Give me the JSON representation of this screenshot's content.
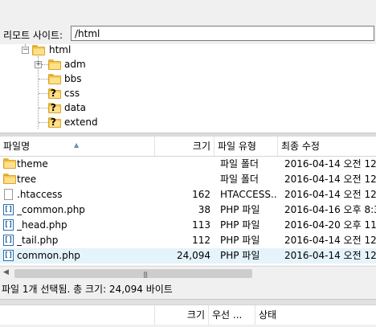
{
  "remote": {
    "label": "리모트 사이트:",
    "path": "/html"
  },
  "tree": {
    "root": "html",
    "children": [
      "adm",
      "bbs",
      "css",
      "data",
      "extend"
    ]
  },
  "list": {
    "columns": [
      "파일명",
      "크기",
      "파일 유형",
      "최종 수정"
    ],
    "rows": [
      {
        "name": "theme",
        "size": "",
        "type": "파일 폴더",
        "modified": "2016-04-14 오전 12:",
        "icon": "folder-icon"
      },
      {
        "name": "tree",
        "size": "",
        "type": "파일 폴더",
        "modified": "2016-04-14 오전 12:",
        "icon": "folder-icon"
      },
      {
        "name": ".htaccess",
        "size": "162",
        "type": "HTACCESS...",
        "modified": "2016-04-14 오전 12:",
        "icon": "document-icon"
      },
      {
        "name": "_common.php",
        "size": "38",
        "type": "PHP 파일",
        "modified": "2016-04-16 오후 8:3",
        "icon": "php-file-icon"
      },
      {
        "name": "_head.php",
        "size": "113",
        "type": "PHP 파일",
        "modified": "2016-04-20 오후 11:",
        "icon": "php-file-icon"
      },
      {
        "name": "_tail.php",
        "size": "112",
        "type": "PHP 파일",
        "modified": "2016-04-14 오전 12:",
        "icon": "php-file-icon"
      },
      {
        "name": "common.php",
        "size": "24,094",
        "type": "PHP 파일",
        "modified": "2016-04-14 오전 12:",
        "icon": "php-file-icon"
      }
    ]
  },
  "status": {
    "text": "파일 1개 선택됨. 총 크기: 24,094 바이트"
  },
  "queue": {
    "columns": [
      "크기",
      "우선 ...",
      "상태"
    ]
  },
  "colors": {
    "selected_row": "#e5f3fb",
    "folder": "#f6cc58",
    "php_icon": "#2d6fb0"
  }
}
